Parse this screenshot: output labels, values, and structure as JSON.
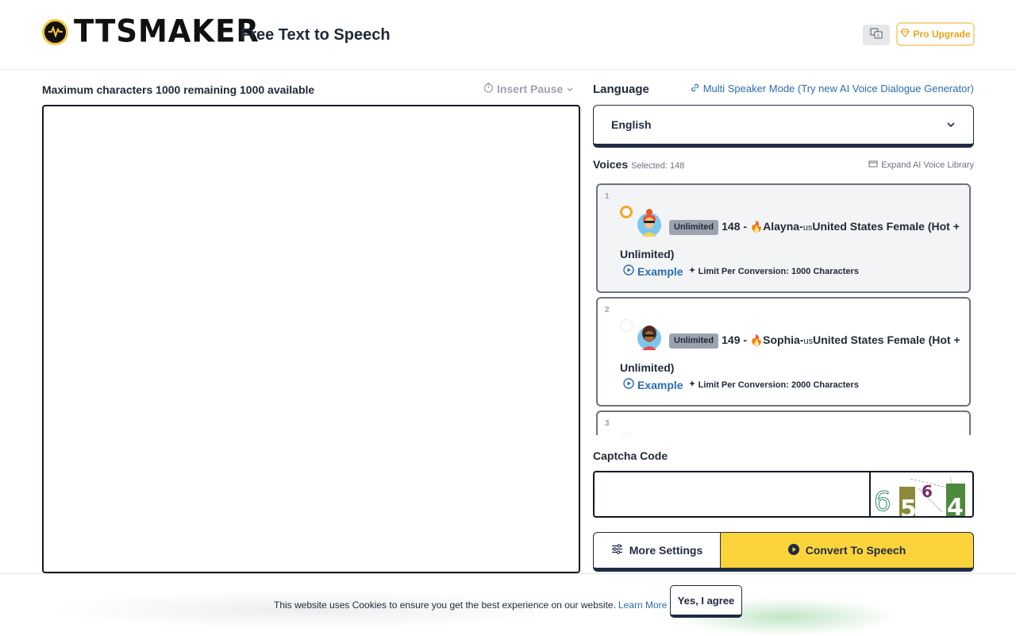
{
  "header": {
    "logo_text": "TTSMAKER",
    "tagline": "Free Text to Speech",
    "language_switch_icon": "translate-icon",
    "pro_label": "Pro Upgrade",
    "pro_icon": "diamond-icon"
  },
  "editor": {
    "max_chars_label": "Maximum characters 1000 remaining 1000 available",
    "insert_pause_label": "Insert Pause",
    "text_value": ""
  },
  "language": {
    "label": "Language",
    "multi_speaker_link": "Multi Speaker Mode (Try new AI Voice Dialogue Generator)",
    "selected": "English"
  },
  "voices": {
    "label": "Voices",
    "selected_count": "Selected: 148",
    "expand_label": "Expand AI Voice Library",
    "items": [
      {
        "num": "1",
        "badge": "Unlimited",
        "id_prefix": "148 - ",
        "name": "Alayna-",
        "cc": "us",
        "desc": "United States Female (Hot + Unlimited)",
        "example": "Example",
        "limit": "Limit Per Conversion: 1000 Characters",
        "selected": true
      },
      {
        "num": "2",
        "badge": "Unlimited",
        "id_prefix": "149 - ",
        "name": "Sophia-",
        "cc": "us",
        "desc": "United States Female (Hot + Unlimited)",
        "example": "Example",
        "limit": "Limit Per Conversion: 2000 Characters",
        "selected": false
      },
      {
        "num": "3"
      }
    ]
  },
  "captcha": {
    "label": "Captcha Code",
    "value": "",
    "image_digits": "6564"
  },
  "actions": {
    "more_settings": "More Settings",
    "convert": "Convert To Speech"
  },
  "cookie": {
    "text": "This website uses Cookies to ensure you get the best experience on our website.",
    "learn_more": "Learn More",
    "agree": "Yes, I agree"
  },
  "colors": {
    "accent_yellow": "#fbd33b",
    "navy": "#1f2a44",
    "link_blue": "#2b6cb0",
    "pro_orange": "#e8a617"
  }
}
